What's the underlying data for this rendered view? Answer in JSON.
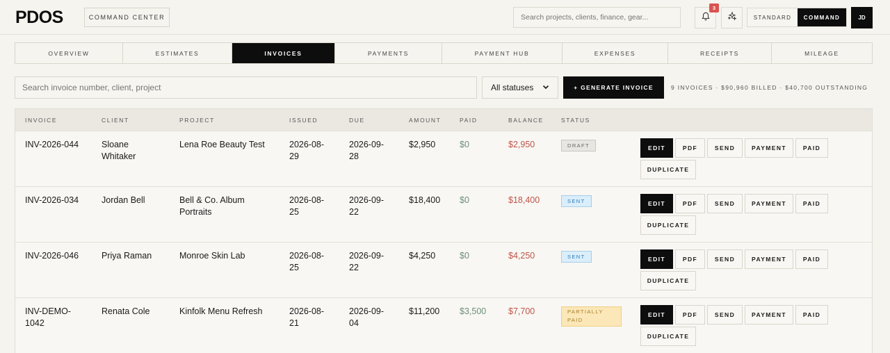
{
  "header": {
    "logo": "PDOS",
    "command_center": "COMMAND CENTER",
    "search_placeholder": "Search projects, clients, finance, gear...",
    "notification_count": "3",
    "mode_standard": "STANDARD",
    "mode_command": "COMMAND",
    "avatar_initials": "JD"
  },
  "tabs": [
    {
      "label": "OVERVIEW"
    },
    {
      "label": "ESTIMATES"
    },
    {
      "label": "INVOICES",
      "active": true
    },
    {
      "label": "PAYMENTS"
    },
    {
      "label": "PAYMENT HUB"
    },
    {
      "label": "EXPENSES"
    },
    {
      "label": "RECEIPTS"
    },
    {
      "label": "MILEAGE"
    }
  ],
  "filters": {
    "search_placeholder": "Search invoice number, client, project",
    "status_value": "All statuses",
    "generate_label": "+ GENERATE INVOICE",
    "summary": "9 INVOICES · $90,960 BILLED · $40,700 OUTSTANDING"
  },
  "table": {
    "columns": [
      "INVOICE",
      "CLIENT",
      "PROJECT",
      "ISSUED",
      "DUE",
      "AMOUNT",
      "PAID",
      "BALANCE",
      "STATUS"
    ],
    "actions": [
      "EDIT",
      "PDF",
      "SEND",
      "PAYMENT",
      "PAID",
      "DUPLICATE"
    ],
    "rows": [
      {
        "invoice": "INV-2026-044",
        "client": "Sloane Whitaker",
        "project": "Lena Roe Beauty Test",
        "issued": "2026-08-29",
        "due": "2026-09-28",
        "amount": "$2,950",
        "paid": "$0",
        "balance": "$2,950",
        "status": "DRAFT",
        "status_kind": "draft"
      },
      {
        "invoice": "INV-2026-034",
        "client": "Jordan Bell",
        "project": "Bell & Co. Album Portraits",
        "issued": "2026-08-25",
        "due": "2026-09-22",
        "amount": "$18,400",
        "paid": "$0",
        "balance": "$18,400",
        "status": "SENT",
        "status_kind": "sent"
      },
      {
        "invoice": "INV-2026-046",
        "client": "Priya Raman",
        "project": "Monroe Skin Lab",
        "issued": "2026-08-25",
        "due": "2026-09-22",
        "amount": "$4,250",
        "paid": "$0",
        "balance": "$4,250",
        "status": "SENT",
        "status_kind": "sent"
      },
      {
        "invoice": "INV-DEMO-1042",
        "client": "Renata Cole",
        "project": "Kinfolk Menu Refresh",
        "issued": "2026-08-21",
        "due": "2026-09-04",
        "amount": "$11,200",
        "paid": "$3,500",
        "balance": "$7,700",
        "status": "PARTIALLY PAID",
        "status_kind": "partial"
      }
    ]
  },
  "colors": {
    "background": "#f6f4ef",
    "primary": "#0d0d0d",
    "paid": "#6d8f78",
    "balance": "#c0544a",
    "badge_sent": "#2b7bb9",
    "badge_partial": "#a77c2a",
    "notification": "#d9534f"
  },
  "icons": {
    "bell": "bell-icon",
    "sparkle": "sparkle-icon",
    "select": "chevron-down-icon"
  }
}
